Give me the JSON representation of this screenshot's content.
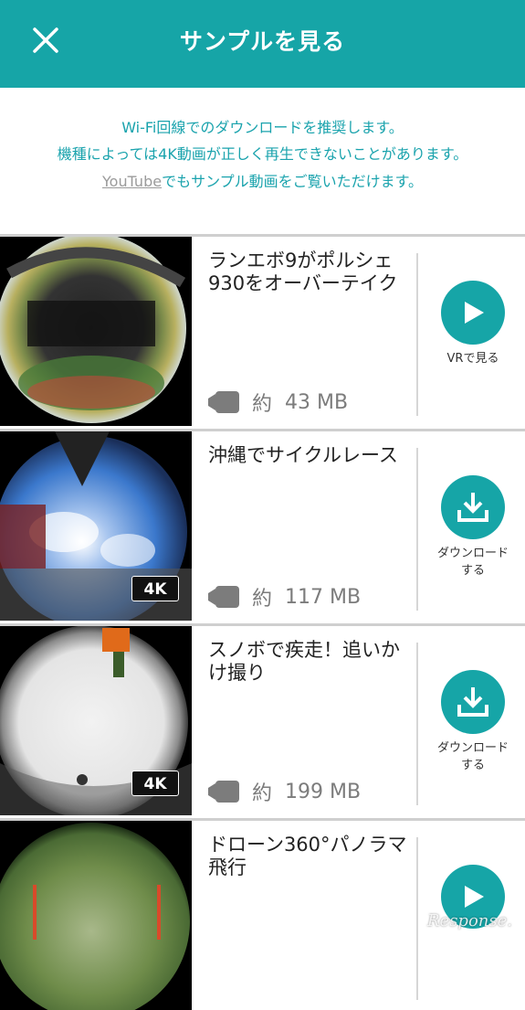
{
  "header": {
    "title": "サンプルを見る",
    "close_icon": "close-icon"
  },
  "notice": {
    "line1": "Wi-Fi回線でのダウンロードを推奨します。",
    "line2": "機種によっては4K動画が正しく再生できないことがあります。",
    "line3_link": "YouTube",
    "line3_rest": "でもサンプル動画をご覧いただけます。"
  },
  "colors": {
    "accent": "#16a5a7",
    "link_gray": "#9b9b9b",
    "notice_text": "#1aa3ad"
  },
  "videos": [
    {
      "title": "ランエボ9がポルシェ930をオーバーテイク",
      "size_prefix": "約",
      "size": "43 MB",
      "badge": "",
      "action_icon": "play-icon",
      "action_label": "VRで見る"
    },
    {
      "title": "沖縄でサイクルレース",
      "size_prefix": "約",
      "size": "117 MB",
      "badge": "4K",
      "action_icon": "download-icon",
      "action_label": "ダウンロード\nする"
    },
    {
      "title": "スノボで疾走！追いかけ撮り",
      "size_prefix": "約",
      "size": "199 MB",
      "badge": "4K",
      "action_icon": "download-icon",
      "action_label": "ダウンロード\nする"
    },
    {
      "title": "ドローン360°パノラマ飛行",
      "size_prefix": "",
      "size": "",
      "badge": "",
      "action_icon": "play-icon",
      "action_label": ""
    }
  ],
  "watermark": "Response."
}
